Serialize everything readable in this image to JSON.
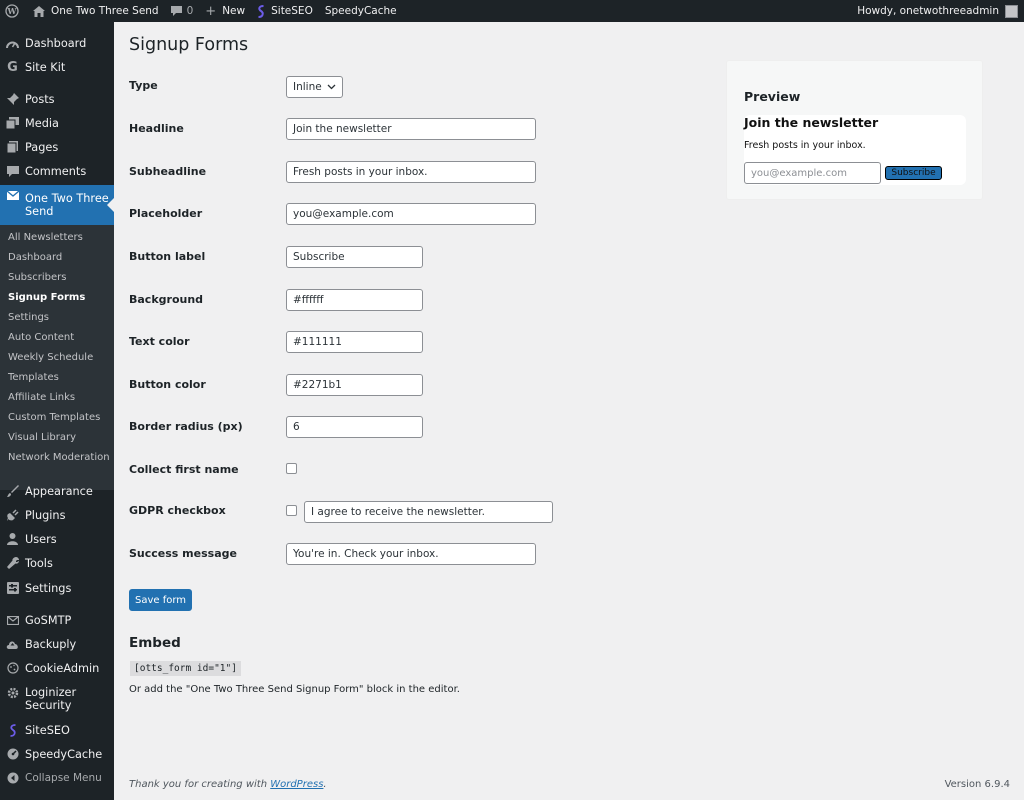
{
  "adminbar": {
    "site_name": "One Two Three Send",
    "comments_count": "0",
    "new_label": "New",
    "siteseo_label": "SiteSEO",
    "speedycache_label": "SpeedyCache",
    "howdy": "Howdy, onetwothreeadmin"
  },
  "sidebar": {
    "dashboard": "Dashboard",
    "sitekit": "Site Kit",
    "posts": "Posts",
    "media": "Media",
    "pages": "Pages",
    "comments": "Comments",
    "plugin_line1": "One Two Three",
    "plugin_line2": "Send",
    "submenu": [
      "All Newsletters",
      "Dashboard",
      "Subscribers",
      "Signup Forms",
      "Settings",
      "Auto Content",
      "Weekly Schedule",
      "Templates",
      "Affiliate Links",
      "Custom Templates",
      "Visual Library",
      "Network Moderation"
    ],
    "appearance": "Appearance",
    "plugins": "Plugins",
    "users": "Users",
    "tools": "Tools",
    "settings": "Settings",
    "gosmtp": "GoSMTP",
    "backuply": "Backuply",
    "cookieadmin": "CookieAdmin",
    "loginizer_line1": "Loginizer",
    "loginizer_line2": "Security",
    "siteseo": "SiteSEO",
    "speedycache": "SpeedyCache",
    "collapse": "Collapse Menu"
  },
  "page": {
    "title": "Signup Forms",
    "fields": {
      "type": {
        "label": "Type",
        "value": "Inline"
      },
      "headline": {
        "label": "Headline",
        "value": "Join the newsletter"
      },
      "subheadline": {
        "label": "Subheadline",
        "value": "Fresh posts in your inbox."
      },
      "placeholder": {
        "label": "Placeholder",
        "value": "you@example.com"
      },
      "button_label": {
        "label": "Button label",
        "value": "Subscribe"
      },
      "background": {
        "label": "Background",
        "value": "#ffffff"
      },
      "text_color": {
        "label": "Text color",
        "value": "#111111"
      },
      "button_color": {
        "label": "Button color",
        "value": "#2271b1"
      },
      "border_radius": {
        "label": "Border radius (px)",
        "value": "6"
      },
      "collect_first_name": {
        "label": "Collect first name",
        "checked": false
      },
      "gdpr": {
        "label": "GDPR checkbox",
        "checked": false,
        "text": "I agree to receive the newsletter."
      },
      "success": {
        "label": "Success message",
        "value": "You're in. Check your inbox."
      }
    },
    "save_label": "Save form",
    "embed": {
      "title": "Embed",
      "shortcode": "[otts_form id=\"1\"]",
      "help": "Or add the \"One Two Three Send Signup Form\" block in the editor."
    }
  },
  "preview": {
    "title": "Preview",
    "headline": "Join the newsletter",
    "subheadline": "Fresh posts in your inbox.",
    "placeholder": "you@example.com",
    "button": "Subscribe"
  },
  "footer": {
    "thanks_prefix": "Thank you for creating with ",
    "thanks_link": "WordPress",
    "thanks_suffix": ".",
    "version": "Version 6.9.4"
  },
  "colors": {
    "accent": "#2271b1",
    "adminbar_bg": "#1d2327",
    "submenu_bg": "#2c3338",
    "content_bg": "#f0f0f1"
  }
}
